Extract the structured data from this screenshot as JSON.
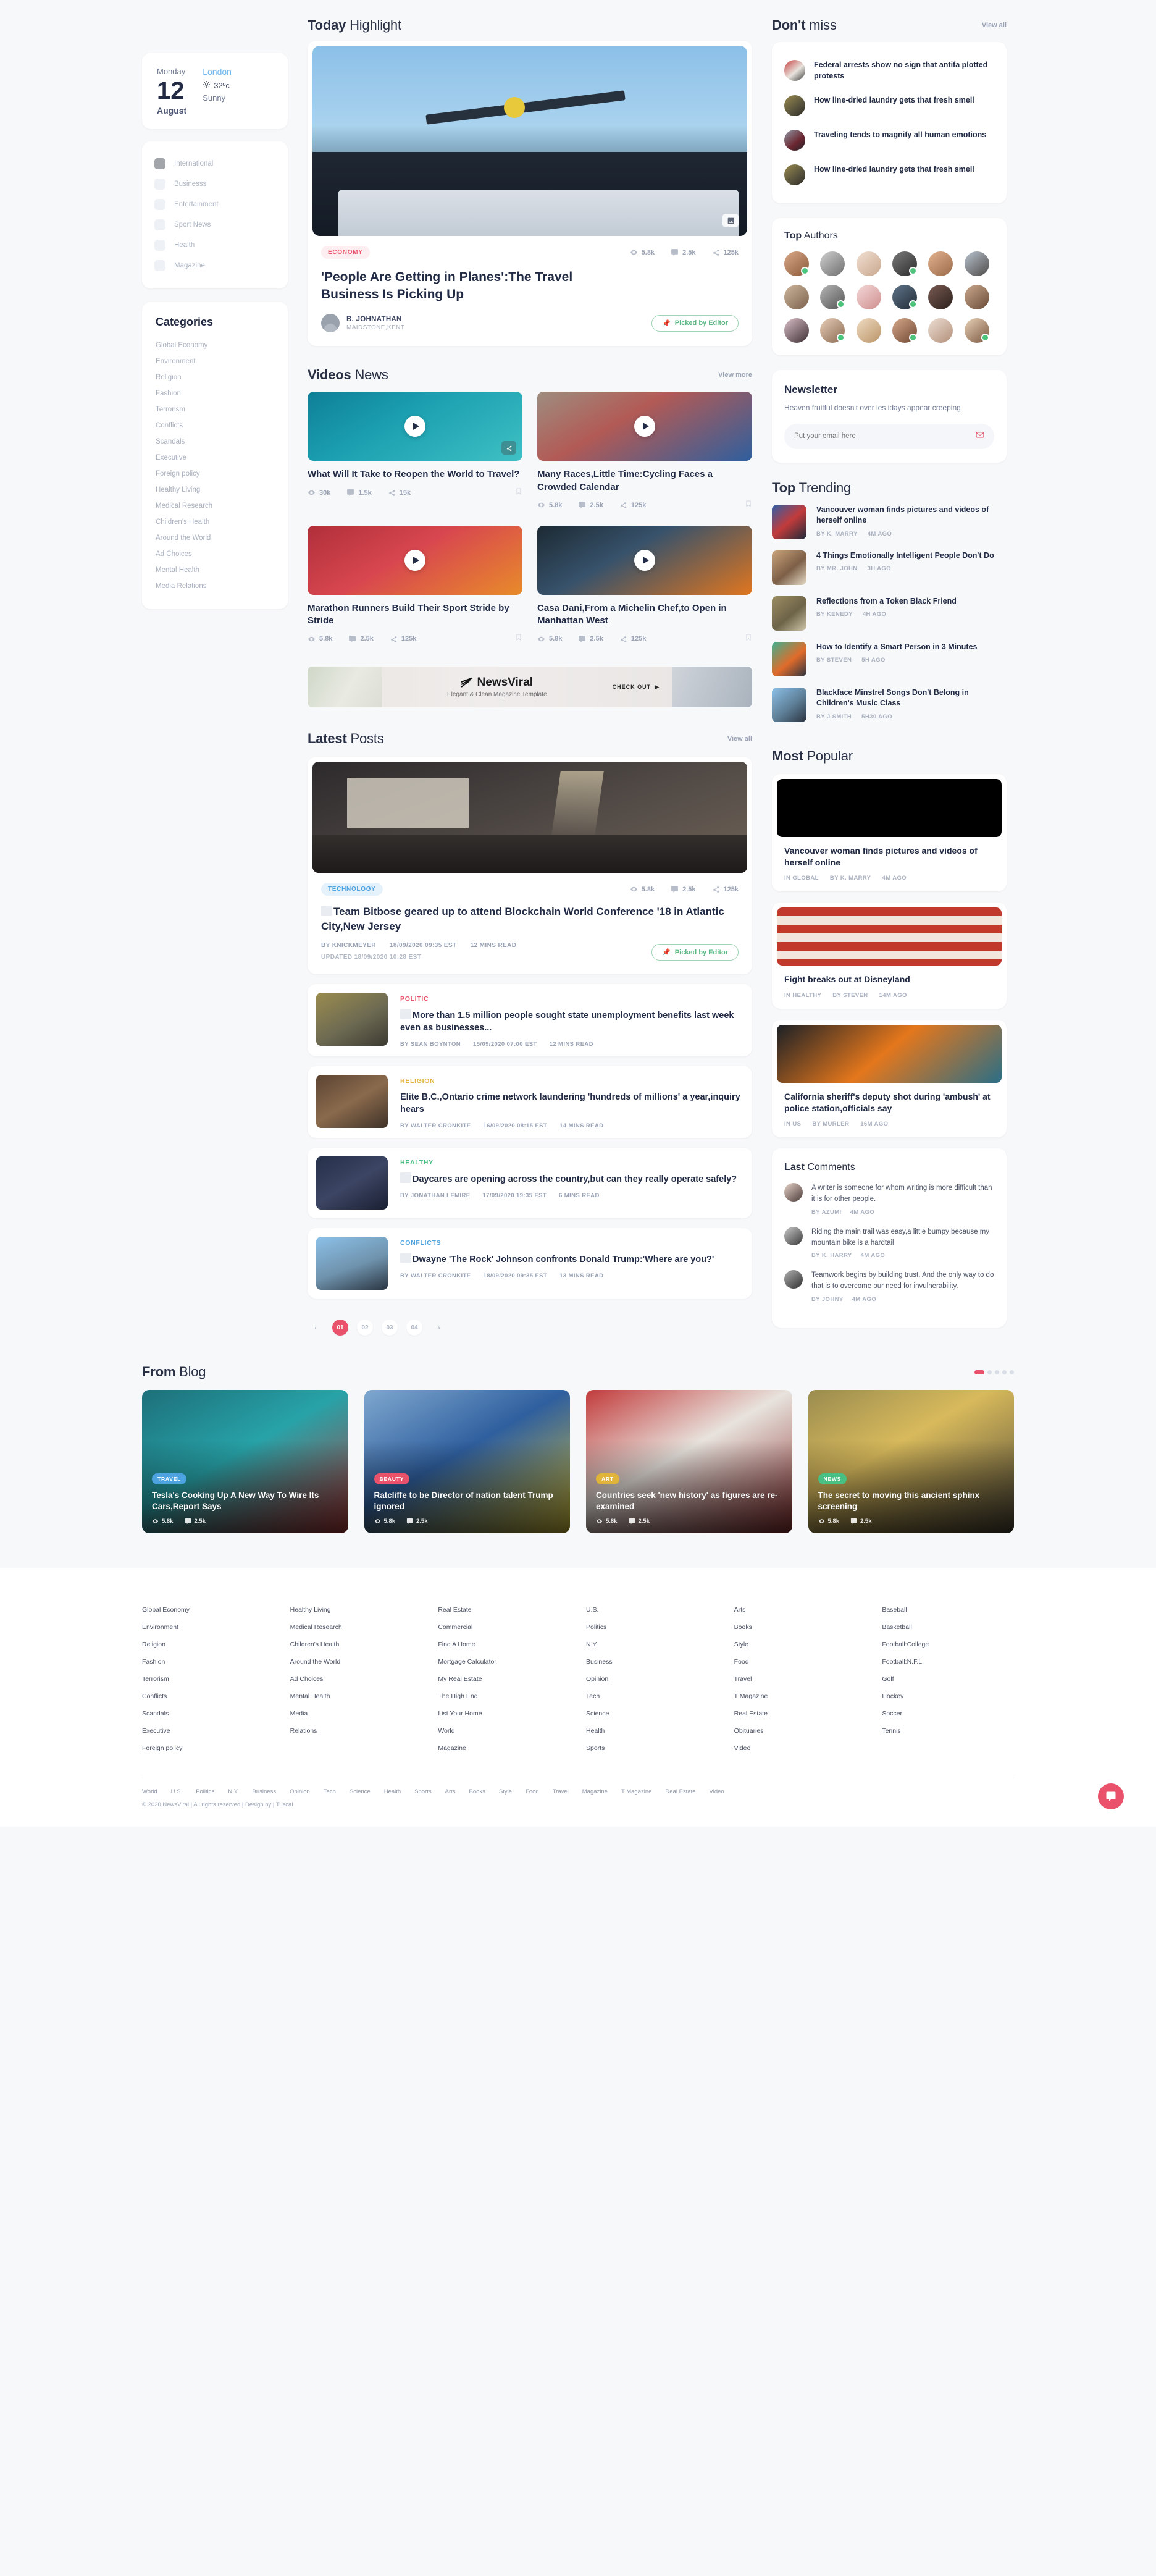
{
  "weather": {
    "day": "Monday",
    "date": "12",
    "month": "August",
    "city": "London",
    "temp": "32ºc",
    "condition": "Sunny"
  },
  "channels": {
    "items": [
      {
        "label": "International",
        "on": true
      },
      {
        "label": "Businesss",
        "on": false
      },
      {
        "label": "Entertainment",
        "on": false
      },
      {
        "label": "Sport News",
        "on": false
      },
      {
        "label": "Health",
        "on": false
      },
      {
        "label": "Magazine",
        "on": false
      }
    ]
  },
  "categories": {
    "title": "Categories",
    "items": [
      "Global Economy",
      "Environment",
      "Religion",
      "Fashion",
      "Terrorism",
      "Conflicts",
      "Scandals",
      "Executive",
      "Foreign policy",
      "Healthy Living",
      "Medical Research",
      "Children's Health",
      "Around the World",
      "Ad Choices",
      "Mental Health",
      "Media Relations"
    ]
  },
  "today": {
    "title_bold": "Today",
    "title_rest": " Highlight",
    "hero": {
      "category": "ECONOMY",
      "title": "'People Are Getting in Planes':The Travel Business Is Picking Up",
      "author": "B. JOHNATHAN",
      "location": "MAIDSTONE,KENT",
      "views": "5.8k",
      "comments": "2.5k",
      "shares": "125k",
      "picked_label": "Picked by Editor"
    }
  },
  "videos": {
    "title_bold": "Videos",
    "title_rest": " News",
    "view_more": "View more",
    "items": [
      {
        "title": "What Will It Take to Reopen the World to Travel?",
        "views": "30k",
        "comments": "1.5k",
        "shares": "15k",
        "has_share_chip": true
      },
      {
        "title": "Many Races,Little Time:Cycling Faces a Crowded Calendar",
        "views": "5.8k",
        "comments": "2.5k",
        "shares": "125k",
        "has_share_chip": false
      },
      {
        "title": "Marathon Runners Build Their Sport Stride by Stride",
        "views": "5.8k",
        "comments": "2.5k",
        "shares": "125k",
        "has_share_chip": false
      },
      {
        "title": "Casa Dani,From a Michelin Chef,to Open in Manhattan West",
        "views": "5.8k",
        "comments": "2.5k",
        "shares": "125k",
        "has_share_chip": false
      }
    ]
  },
  "banner": {
    "brand": "NewsViral",
    "tagline": "Elegant & Clean Magazine Template",
    "cta": "CHECK OUT"
  },
  "latest": {
    "title_bold": "Latest",
    "title_rest": " Posts",
    "view_all": "View all",
    "featured": {
      "category": "TECHNOLOGY",
      "title": "Team Bitbose geared up to attend Blockchain World Conference '18 in Atlantic City,New Jersey",
      "author": "BY KNICKMEYER",
      "date": "18/09/2020 09:35 EST",
      "read": "12 MINS READ",
      "updated": "UPDATED 18/09/2020 10:28 EST",
      "views": "5.8k",
      "comments": "2.5k",
      "shares": "125k",
      "picked_label": "Picked by Editor"
    },
    "posts": [
      {
        "category": "POLITIC",
        "cat_class": "c-politic",
        "title": "More than 1.5 million people sought state unemployment benefits last week even as businesses...",
        "author": "BY SEAN BOYNTON",
        "date": "15/09/2020 07:00 EST",
        "read": "12 MINS READ"
      },
      {
        "category": "RELIGION",
        "cat_class": "c-religion",
        "title": "Elite B.C.,Ontario crime network laundering 'hundreds of millions' a year,inquiry hears",
        "author": "BY WALTER CRONKITE",
        "date": "16/09/2020 08:15 EST",
        "read": "14 MINS READ"
      },
      {
        "category": "HEALTHY",
        "cat_class": "c-healthy",
        "title": "Daycares are opening across the country,but can they really operate safely?",
        "author": "BY JONATHAN LEMIRE",
        "date": "17/09/2020 19:35 EST",
        "read": "6 MINS READ"
      },
      {
        "category": "CONFLICTS",
        "cat_class": "c-conflicts",
        "title": "Dwayne 'The Rock' Johnson confronts Donald Trump:'Where are you?'",
        "author": "BY WALTER CRONKITE",
        "date": "18/09/2020 09:35 EST",
        "read": "13 MINS READ"
      }
    ],
    "pagination": {
      "pages": [
        "01",
        "02",
        "03",
        "04"
      ],
      "active": "01"
    }
  },
  "dont_miss": {
    "title_bold": "Don't",
    "title_rest": " miss",
    "view_all": "View all",
    "items": [
      {
        "title": "Federal arrests show no sign that antifa plotted protests"
      },
      {
        "title": "How line-dried laundry gets that fresh smell"
      },
      {
        "title": "Traveling tends to magnify all human emotions"
      },
      {
        "title": "How line-dried laundry gets that fresh smell"
      }
    ]
  },
  "top_authors": {
    "title_bold": "Top",
    "title_rest": " Authors",
    "count": 18
  },
  "newsletter": {
    "title": "Newsletter",
    "text": "Heaven fruitful doesn't over les idays appear creeping",
    "placeholder": "Put your email here"
  },
  "top_trending": {
    "title_bold": "Top",
    "title_rest": " Trending",
    "items": [
      {
        "title": "Vancouver woman finds pictures and videos of herself online",
        "author": "BY K. MARRY",
        "ago": "4M AGO"
      },
      {
        "title": "4 Things Emotionally Intelligent People Don't Do",
        "author": "BY MR. JOHN",
        "ago": "3H AGO"
      },
      {
        "title": "Reflections from a Token Black Friend",
        "author": "BY KENEDY",
        "ago": "4H AGO"
      },
      {
        "title": "How to Identify a Smart Person in 3 Minutes",
        "author": "BY STEVEN",
        "ago": "5H AGO"
      },
      {
        "title": "Blackface Minstrel Songs Don't Belong in Children's Music Class",
        "author": "BY J.SMITH",
        "ago": "5H30 AGO"
      }
    ]
  },
  "most_popular": {
    "title_bold": "Most",
    "title_rest": " Popular",
    "items": [
      {
        "title": "Vancouver woman finds pictures and videos of herself online",
        "section": "IN GLOBAL",
        "author": "BY K. MARRY",
        "ago": "4M AGO"
      },
      {
        "title": "Fight breaks out at Disneyland",
        "section": "IN HEALTHY",
        "author": "BY STEVEN",
        "ago": "14M AGO"
      },
      {
        "title": "California sheriff's deputy shot during 'ambush' at police station,officials say",
        "section": "IN US",
        "author": "BY MURLER",
        "ago": "16M AGO"
      }
    ]
  },
  "last_comments": {
    "title_bold": "Last",
    "title_rest": " Comments",
    "items": [
      {
        "text": "A writer is someone for whom writing is more difficult than it is for other people.",
        "author": "BY AZUMI",
        "ago": "4M AGO"
      },
      {
        "text": "Riding the main trail was easy,a little bumpy because my mountain bike is a hardtail",
        "author": "BY K. HARRY",
        "ago": "4M AGO"
      },
      {
        "text": "Teamwork begins by building trust. And the only way to do that is to overcome our need for invulnerability.",
        "author": "BY JOHNY",
        "ago": "4M AGO"
      }
    ]
  },
  "from_blog": {
    "title_bold": "From",
    "title_rest": " Blog",
    "items": [
      {
        "category": "TRAVEL",
        "cat_color": "#4da3e0",
        "title": "Tesla's Cooking Up A New Way To Wire Its Cars,Report Says",
        "views": "5.8k",
        "comments": "2.5k"
      },
      {
        "category": "BEAUTY",
        "cat_color": "#e9526a",
        "title": "Ratcliffe to be Director of nation talent Trump ignored",
        "views": "5.8k",
        "comments": "2.5k"
      },
      {
        "category": "ART",
        "cat_color": "#e0b33a",
        "title": "Countries seek 'new history' as figures are re-examined",
        "views": "5.8k",
        "comments": "2.5k"
      },
      {
        "category": "NEWS",
        "cat_color": "#49bf84",
        "title": "The secret to moving this ancient sphinx screening",
        "views": "5.8k",
        "comments": "2.5k"
      }
    ]
  },
  "footer": {
    "columns": [
      [
        "Global Economy",
        "Environment",
        "Religion",
        "Fashion",
        "Terrorism",
        "Conflicts",
        "Scandals",
        "Executive",
        "Foreign policy"
      ],
      [
        "Healthy Living",
        "Medical Research",
        "Children's Health",
        "Around the World",
        "Ad Choices",
        "Mental Health",
        "Media",
        "Relations"
      ],
      [
        "Real Estate",
        "Commercial",
        "Find A Home",
        "Mortgage Calculator",
        "My Real Estate",
        "The High End",
        "List Your Home",
        "World",
        "Magazine"
      ],
      [
        "U.S.",
        "Politics",
        "N.Y.",
        "Business",
        "Opinion",
        "Tech",
        "Science",
        "Health",
        "Sports"
      ],
      [
        "Arts",
        "Books",
        "Style",
        "Food",
        "Travel",
        "T Magazine",
        "Real Estate",
        "Obituaries",
        "Video"
      ],
      [
        "Baseball",
        "Basketball",
        "Football:College",
        "Football:N.F.L.",
        "Golf",
        "Hockey",
        "Soccer",
        "Tennis"
      ]
    ],
    "bottom_links": [
      "World",
      "U.S.",
      "Politics",
      "N.Y.",
      "Business",
      "Opinion",
      "Tech",
      "Science",
      "Health",
      "Sports",
      "Arts",
      "Books",
      "Style",
      "Food",
      "Travel",
      "Magazine",
      "T Magazine",
      "Real Estate",
      "Video"
    ],
    "copyright": "© 2020,NewsViral | All rights reserved | Design by | Tuscal"
  }
}
